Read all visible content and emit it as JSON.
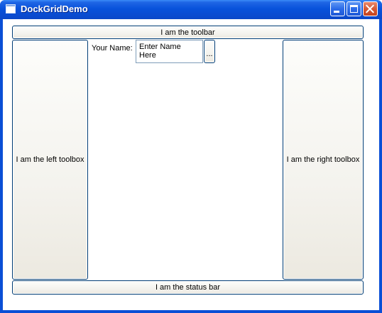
{
  "window": {
    "title": "DockGridDemo",
    "controls": {
      "minimize": "minimize-icon",
      "maximize": "maximize-icon",
      "close": "close-icon"
    }
  },
  "toolbar": {
    "label": "I am the toolbar"
  },
  "left_toolbox": {
    "label": "I am the left toolbox"
  },
  "right_toolbox": {
    "label": "I am the right toolbox"
  },
  "status_bar": {
    "label": "I am the status bar"
  },
  "form": {
    "name_label": "Your Name:",
    "name_value": "Enter Name Here",
    "browse_label": "..."
  },
  "colors": {
    "titlebar": "#0852db",
    "button_border": "#003c74",
    "client_background": "#ffffff"
  }
}
